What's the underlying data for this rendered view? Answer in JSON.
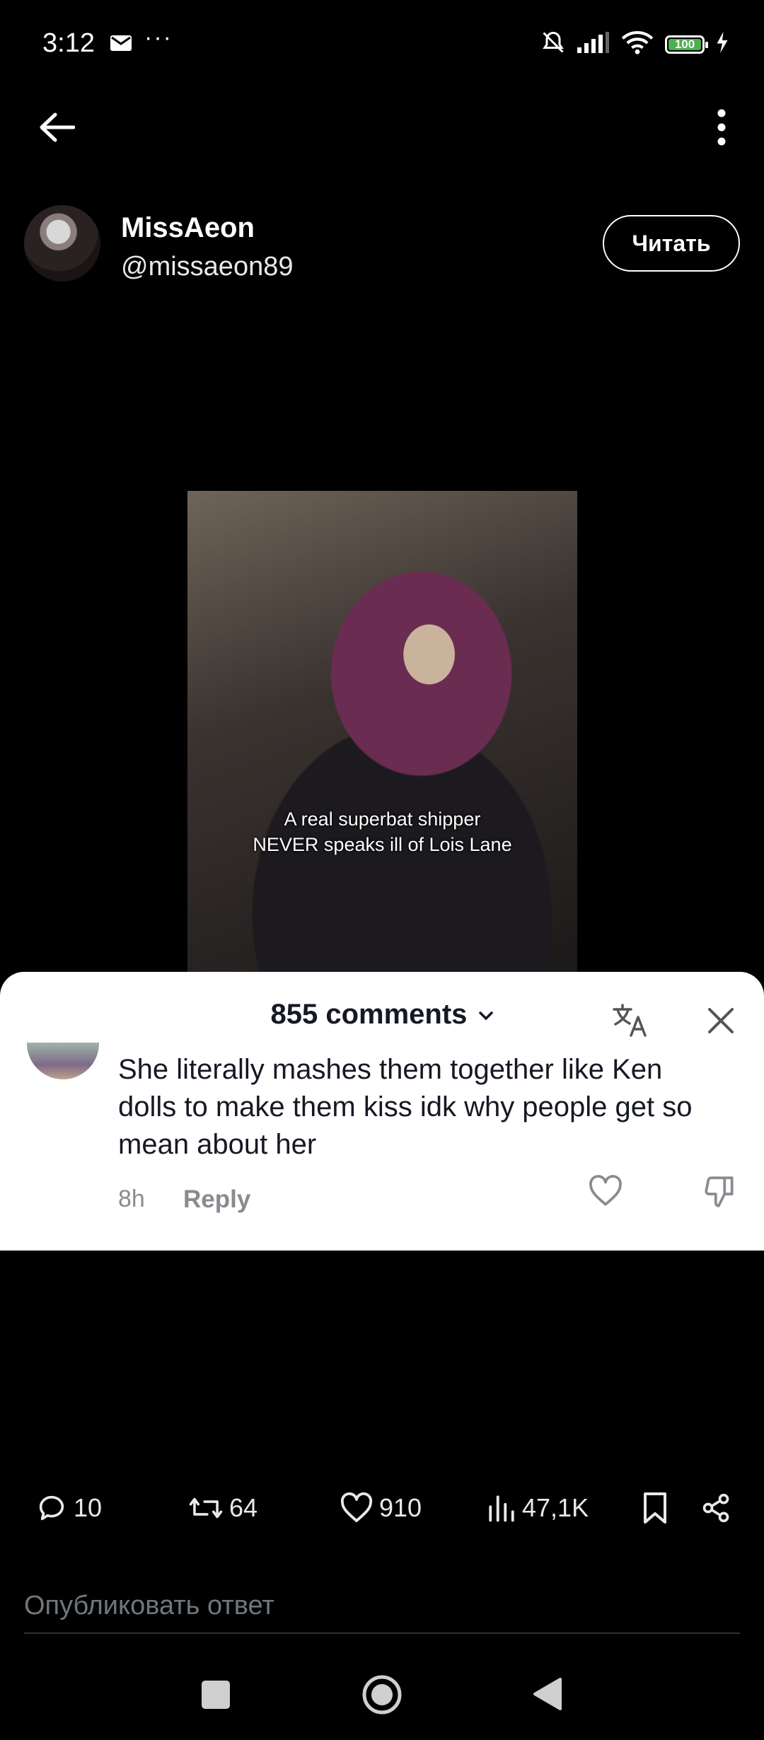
{
  "status_bar": {
    "time": "3:12",
    "more": "···",
    "battery": "100",
    "icons": [
      "mail-icon",
      "mute-icon",
      "signal-icon",
      "wifi-icon",
      "battery-icon",
      "charging-icon"
    ]
  },
  "post": {
    "author_name": "MissAeon",
    "author_handle": "@missaeon89",
    "follow_label": "Читать",
    "video_caption": "A real superbat shipper\nNEVER speaks ill of Lois Lane"
  },
  "comments_sheet": {
    "title": "855 comments",
    "comment": {
      "text": "She literally mashes them together like Ken dolls to make them kiss idk why people get so mean about her",
      "time": "8h",
      "reply_label": "Reply"
    }
  },
  "action_bar": {
    "replies": "10",
    "reposts": "64",
    "likes": "910",
    "views": "47,1K"
  },
  "reply_input": {
    "placeholder": "Опубликовать ответ"
  },
  "colors": {
    "background": "#000000",
    "sheet": "#ffffff",
    "secondary_text": "#71767b",
    "battery": "#4caf50"
  }
}
